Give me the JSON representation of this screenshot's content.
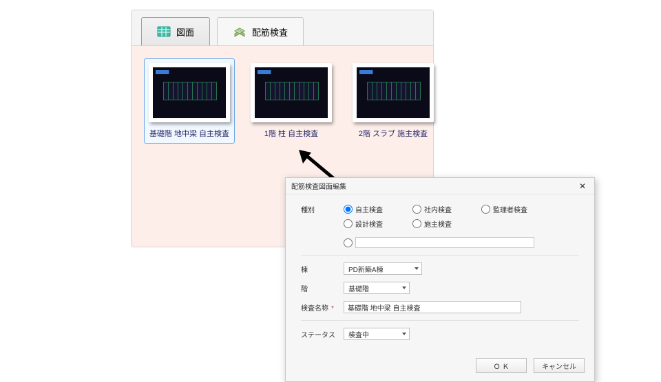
{
  "tabs": {
    "drawings": {
      "label": "図面"
    },
    "rebar_inspection": {
      "label": "配筋検査"
    }
  },
  "thumbnails": [
    {
      "label": "基礎階 地中梁  自主検査",
      "selected": true
    },
    {
      "label": "1階 柱  自主検査",
      "selected": false
    },
    {
      "label": "2階  スラブ 施主検査",
      "selected": false
    }
  ],
  "dialog": {
    "title": "配筋検査図面編集",
    "labels": {
      "type": "種別",
      "building": "棟",
      "floor": "階",
      "inspection_name": "検査名称",
      "status": "ステータス"
    },
    "type_options": [
      {
        "label": "自主検査",
        "checked": true
      },
      {
        "label": "社内検査",
        "checked": false
      },
      {
        "label": "監理者検査",
        "checked": false
      },
      {
        "label": "設計検査",
        "checked": false
      },
      {
        "label": "施主検査",
        "checked": false
      }
    ],
    "type_other_label": "",
    "building_value": "PD新築A棟",
    "floor_value": "基礎階",
    "inspection_name_value": "基礎階 地中梁  自主検査",
    "status_value": "検査中",
    "required_mark": "*",
    "buttons": {
      "ok": "Ｏ Ｋ",
      "cancel": "キャンセル"
    }
  }
}
